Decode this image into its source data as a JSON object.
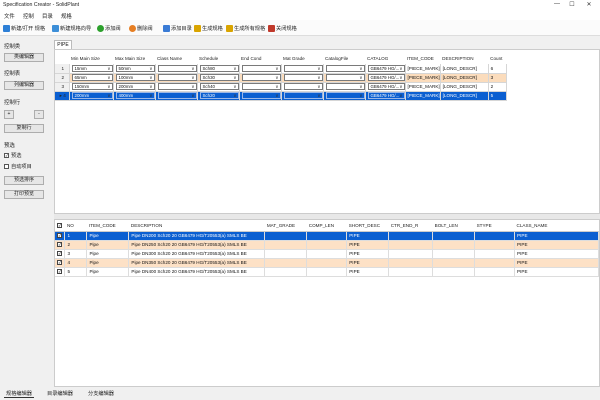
{
  "window": {
    "title": "Specification Creator - SolidPlant",
    "minimize": "—",
    "maximize": "☐",
    "close": "✕"
  },
  "menu": [
    "文件",
    "控制",
    "目录",
    "规格"
  ],
  "toolbar": [
    {
      "label": "新建/打开 规格",
      "icon": "folder-icon",
      "color": "#2d7fd6"
    },
    {
      "label": "新建规格向导",
      "icon": "wizard-icon",
      "color": "#3d8fd8"
    },
    {
      "label": "添加阀",
      "icon": "add-icon",
      "color": "#2ca02c"
    },
    {
      "label": "删除阀",
      "icon": "delete-icon",
      "color": "#e67e22"
    },
    {
      "label": "添加目录",
      "icon": "catalog-icon",
      "color": "#3a7bd5"
    },
    {
      "label": "生成规格",
      "icon": "pencil-icon",
      "color": "#d9a400"
    },
    {
      "label": "生成所有规格",
      "icon": "pencil-icon",
      "color": "#d9a400"
    },
    {
      "label": "关闭规格",
      "icon": "close-doc-icon",
      "color": "#c0392b"
    }
  ],
  "left": {
    "sec1": "控制类",
    "btn1": "类编辑器",
    "sec2": "控制表",
    "btn2": "列编辑器",
    "sec3": "控制行",
    "plus": "+",
    "minus": "-",
    "btn3": "复制行",
    "sec4": "预选",
    "chk1": "预选",
    "chk1_mark": "✓",
    "chk2": "自动项目",
    "btn4": "预选排序",
    "btn5": "打印预览"
  },
  "tab": "PIPE",
  "upper": {
    "headers": [
      "",
      "Min Main Size",
      "Max Main Size",
      "Class Name",
      "Schedule",
      "End Cond",
      "Mat Grade",
      "CatalogFile",
      "CATALOG",
      "ITEM_CODE",
      "DESCRIPTION",
      "Count"
    ],
    "rows": [
      {
        "rh": "1",
        "min": "15mm",
        "max": "50mm",
        "class": "",
        "sch": "Sch80",
        "end": "",
        "mat": "",
        "file": "",
        "catalog": "GB6479 HG/...",
        "code": "[PIECE_MARK]",
        "desc": "[LONG_DESCR]",
        "count": "6"
      },
      {
        "rh": "2",
        "min": "65mm",
        "max": "100mm",
        "class": "",
        "sch": "Sch30",
        "end": "",
        "mat": "",
        "file": "",
        "catalog": "GB6479 HG/...",
        "code": "[PIECE_MARK]",
        "desc": "[LONG_DESCR]",
        "count": "3"
      },
      {
        "rh": "3",
        "min": "150mm",
        "max": "200mm",
        "class": "",
        "sch": "Sch40",
        "end": "",
        "mat": "",
        "file": "",
        "catalog": "GB6479 HG/...",
        "code": "[PIECE_MARK]",
        "desc": "[LONG_DESCR]",
        "count": "2"
      },
      {
        "rh": "▸ 4",
        "min": "200mm",
        "max": "400mm",
        "class": "",
        "sch": "Sch20",
        "end": "",
        "mat": "",
        "file": "",
        "catalog": "GB6479 HG/...",
        "code": "[PIECE_MARK]",
        "desc": "[LONG_DESCR]",
        "count": "5"
      }
    ]
  },
  "lower": {
    "headers": [
      "",
      "NO",
      "ITEM_CODE",
      "DESCRIPTION",
      "MAT_GRADE",
      "COMP_LEN",
      "SHORT_DESC",
      "CTR_END_R",
      "BOLT_LEN",
      "STYPE",
      "CLASS_NAME"
    ],
    "check_mark": "✓",
    "rows": [
      {
        "no": "1",
        "code": "Pipe",
        "desc": "Pipe DN200 Sch20 20 GB6479 HG/T20553(a) SMLS BE",
        "short": "PIPE",
        "cls": "PIPE"
      },
      {
        "no": "2",
        "code": "Pipe",
        "desc": "Pipe DN250 Sch20 20 GB6479 HG/T20553(a) SMLS BE",
        "short": "PIPE",
        "cls": "PIPE"
      },
      {
        "no": "3",
        "code": "Pipe",
        "desc": "Pipe DN300 Sch20 20 GB6479 HG/T20553(a) SMLS BE",
        "short": "PIPE",
        "cls": "PIPE"
      },
      {
        "no": "4",
        "code": "Pipe",
        "desc": "Pipe DN350 Sch20 20 GB6479 HG/T20553(a) SMLS BE",
        "short": "PIPE",
        "cls": "PIPE"
      },
      {
        "no": "5",
        "code": "Pipe",
        "desc": "Pipe DN400 Sch20 20 GB6479 HG/T20553(a) SMLS BE",
        "short": "PIPE",
        "cls": "PIPE"
      }
    ]
  },
  "bottom_tabs": [
    "规格编辑器",
    "目录编辑器",
    "分支编辑器"
  ]
}
